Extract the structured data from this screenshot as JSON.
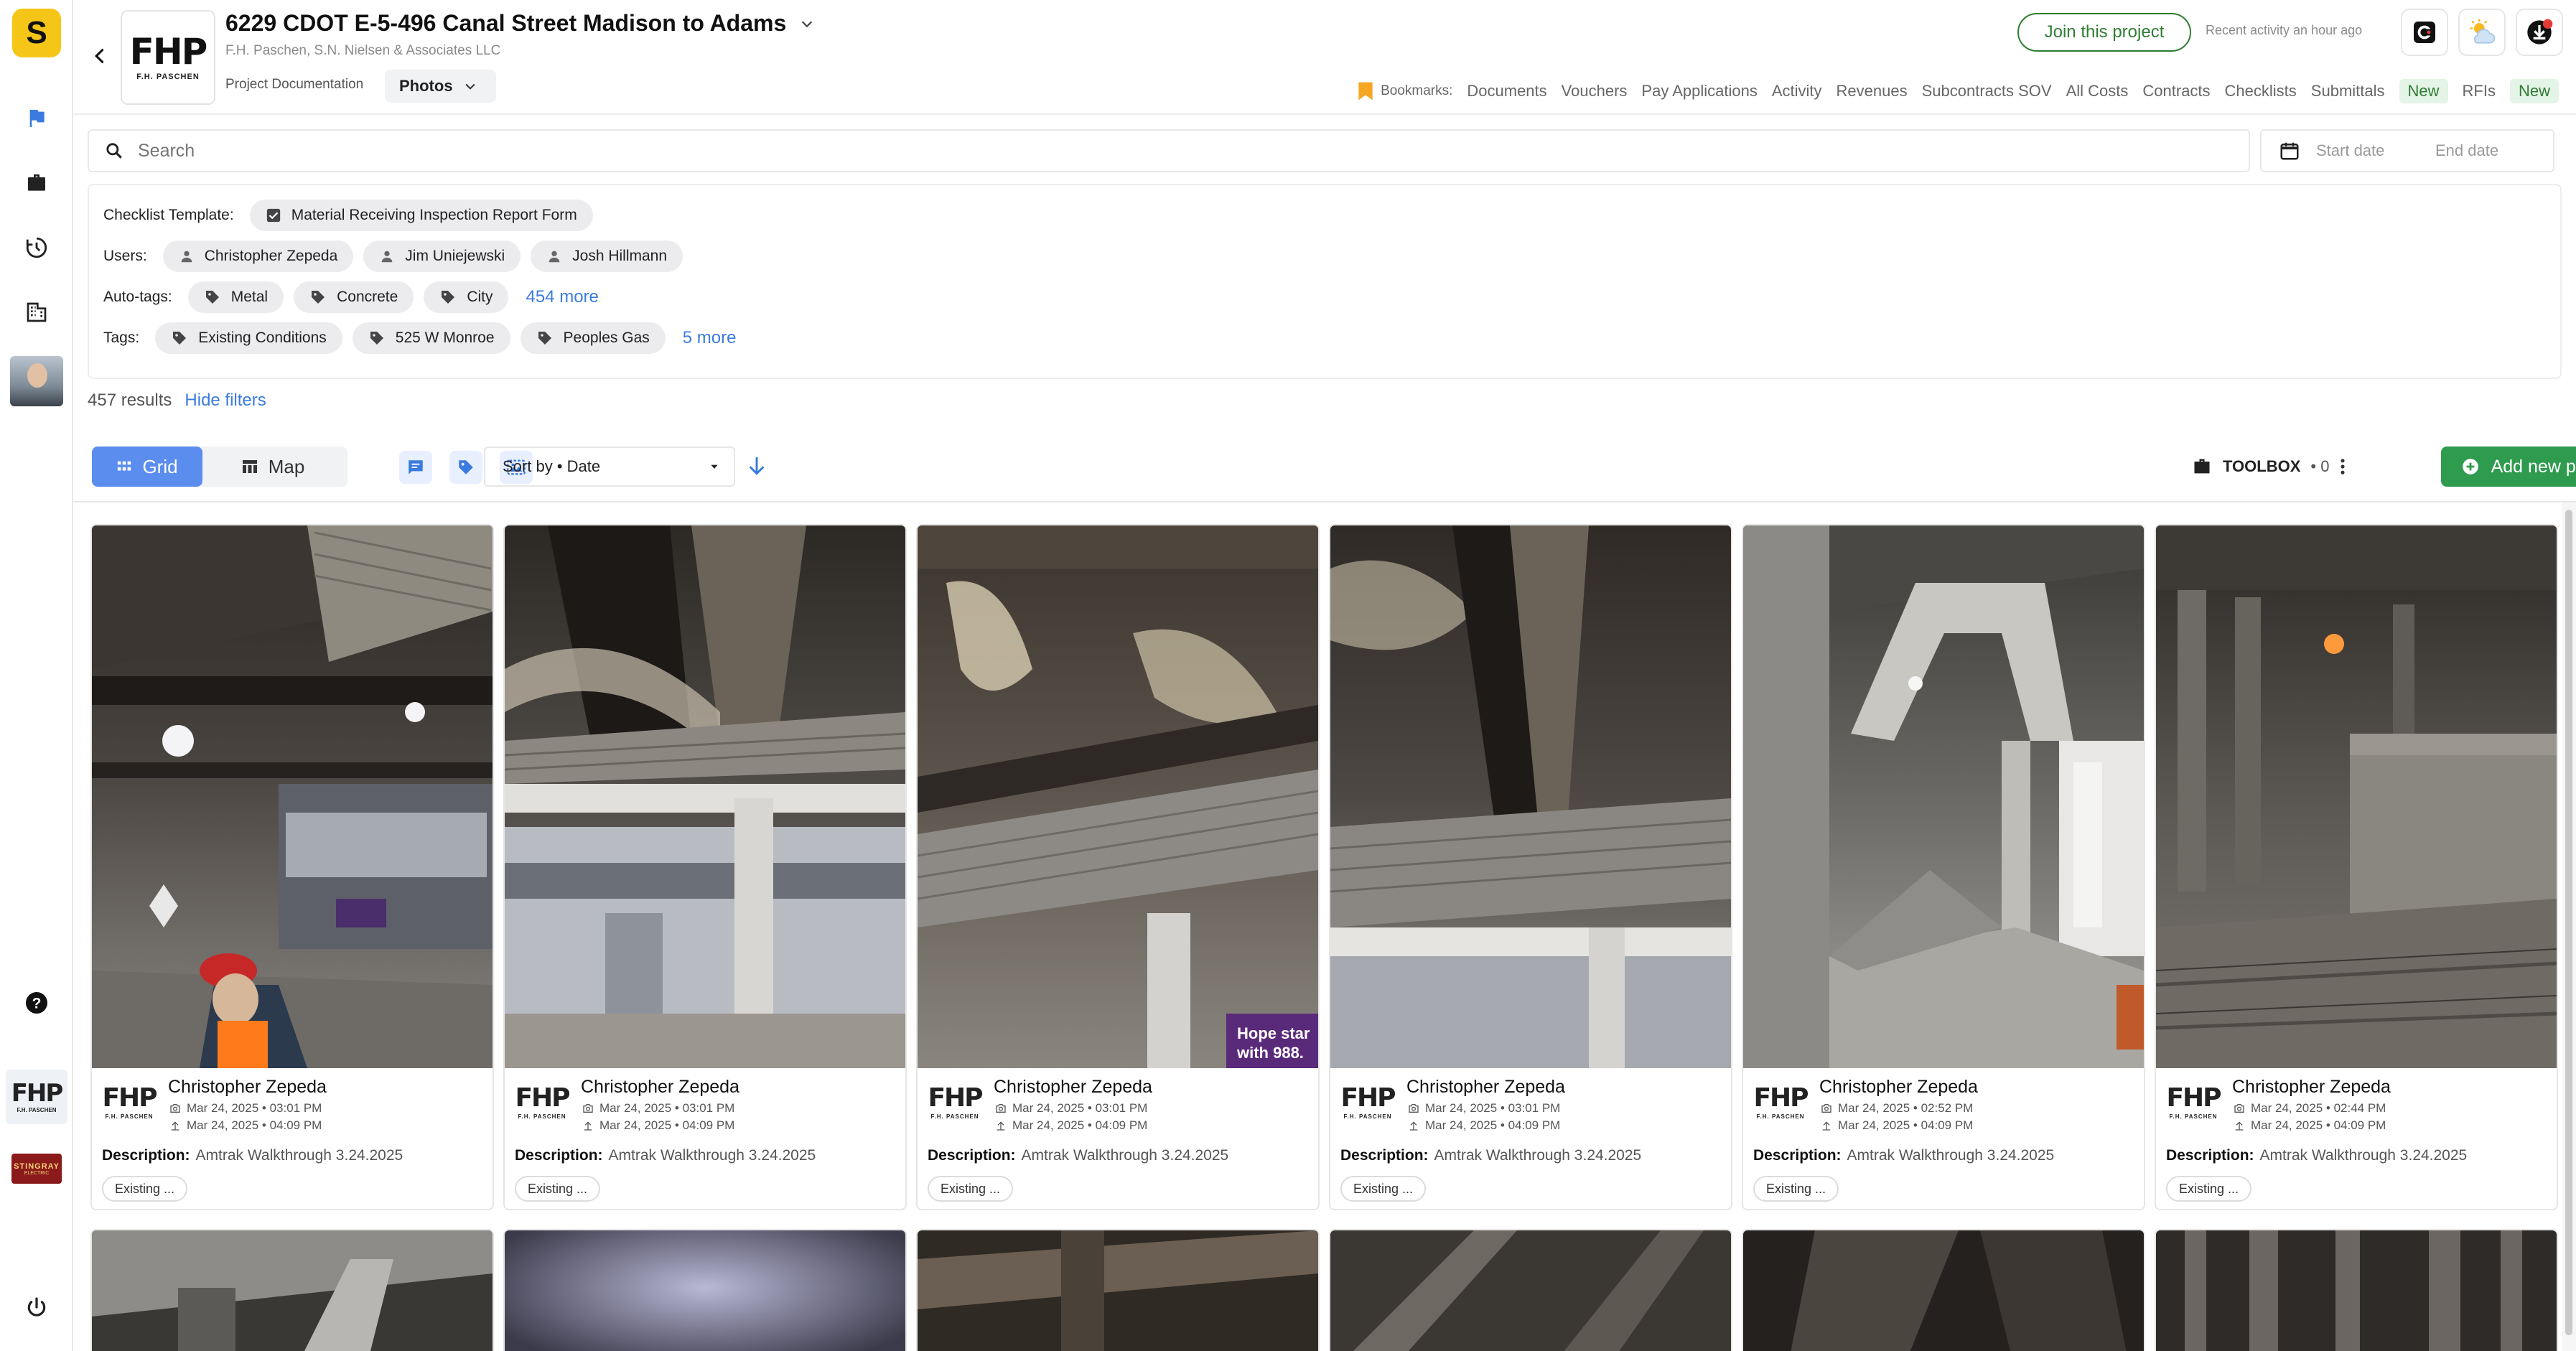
{
  "rail": {
    "logo_letter": "S",
    "company_logo_text": "FHP",
    "company_logo_sub": "F.H. PASCHEN",
    "stingray_text": "STINGRAY",
    "stingray_sub": "ELECTRIC"
  },
  "header": {
    "title": "6229 CDOT E-5-496 Canal Street Madison to Adams",
    "subtitle": "F.H. Paschen, S.N. Nielsen & Associates LLC",
    "logo_text": "FHP",
    "logo_sub": "F.H. PASCHEN",
    "breadcrumb": "Project Documentation",
    "section_select": "Photos",
    "join_label": "Join this project",
    "recent_activity": "Recent activity an hour ago",
    "bookmarks_label": "Bookmarks:",
    "nav": [
      {
        "label": "Documents"
      },
      {
        "label": "Vouchers"
      },
      {
        "label": "Pay Applications"
      },
      {
        "label": "Activity"
      },
      {
        "label": "Revenues"
      },
      {
        "label": "Subcontracts SOV"
      },
      {
        "label": "All Costs"
      },
      {
        "label": "Contracts"
      },
      {
        "label": "Checklists"
      },
      {
        "label": "Submittals"
      },
      {
        "label": "RFIs"
      }
    ],
    "new_badge": "New"
  },
  "search": {
    "placeholder": "Search",
    "start_date": "Start date",
    "end_date": "End date"
  },
  "filters": {
    "checklist_label": "Checklist Template:",
    "checklist_value": "Material Receiving Inspection Report Form",
    "users_label": "Users:",
    "users": [
      "Christopher Zepeda",
      "Jim Uniejewski",
      "Josh Hillmann"
    ],
    "autotags_label": "Auto-tags:",
    "autotags": [
      "Metal",
      "Concrete",
      "City"
    ],
    "autotags_more": "454 more",
    "tags_label": "Tags:",
    "tags": [
      "Existing Conditions",
      "525 W Monroe",
      "Peoples Gas"
    ],
    "tags_more": "5 more"
  },
  "results": {
    "count": "457 results",
    "hide_filters": "Hide filters"
  },
  "toolbar": {
    "grid_label": "Grid",
    "map_label": "Map",
    "sort_label": "Sort by • Date",
    "toolbox_label": "TOOLBOX",
    "toolbox_count": "• 0",
    "add_photo_label": "Add new photo"
  },
  "photos": [
    {
      "user": "Christopher Zepeda",
      "taken": "Mar 24, 2025 • 03:01 PM",
      "uploaded": "Mar 24, 2025 • 04:09 PM",
      "desc_label": "Description:",
      "description": "Amtrak Walkthrough 3.24.2025",
      "tag": "Existing ...",
      "scene": "platform-worker"
    },
    {
      "user": "Christopher Zepeda",
      "taken": "Mar 24, 2025 • 03:01 PM",
      "uploaded": "Mar 24, 2025 • 04:09 PM",
      "desc_label": "Description:",
      "description": "Amtrak Walkthrough 3.24.2025",
      "tag": "Existing ...",
      "scene": "train-underside"
    },
    {
      "user": "Christopher Zepeda",
      "taken": "Mar 24, 2025 • 03:01 PM",
      "uploaded": "Mar 24, 2025 • 04:09 PM",
      "desc_label": "Description:",
      "description": "Amtrak Walkthrough 3.24.2025",
      "tag": "Existing ...",
      "scene": "beam-closeup",
      "sign_line1": "Hope star",
      "sign_line2": "with 988."
    },
    {
      "user": "Christopher Zepeda",
      "taken": "Mar 24, 2025 • 03:01 PM",
      "uploaded": "Mar 24, 2025 • 04:09 PM",
      "desc_label": "Description:",
      "description": "Amtrak Walkthrough 3.24.2025",
      "tag": "Existing ...",
      "scene": "deck-steel"
    },
    {
      "user": "Christopher Zepeda",
      "taken": "Mar 24, 2025 • 02:52 PM",
      "uploaded": "Mar 24, 2025 • 04:09 PM",
      "desc_label": "Description:",
      "description": "Amtrak Walkthrough 3.24.2025",
      "tag": "Existing ...",
      "scene": "concrete-ramp"
    },
    {
      "user": "Christopher Zepeda",
      "taken": "Mar 24, 2025 • 02:44 PM",
      "uploaded": "Mar 24, 2025 • 04:09 PM",
      "desc_label": "Description:",
      "description": "Amtrak Walkthrough 3.24.2025",
      "tag": "Existing ...",
      "scene": "track-columns"
    }
  ]
}
